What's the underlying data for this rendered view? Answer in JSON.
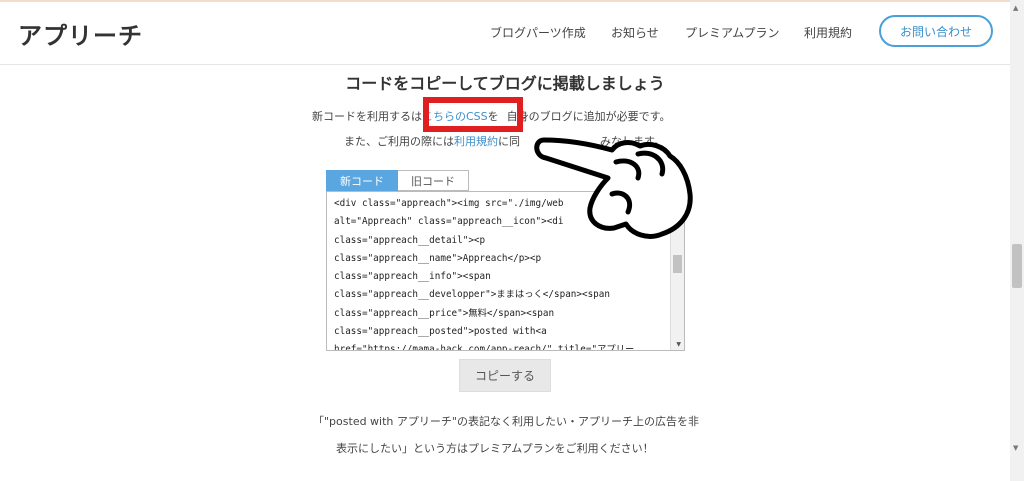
{
  "header": {
    "logo": "アプリーチ",
    "nav": [
      "ブログパーツ作成",
      "お知らせ",
      "プレミアムプラン",
      "利用規約"
    ],
    "contact": "お問い合わせ"
  },
  "main": {
    "title": "コードをコピーしてブログに掲載しましょう",
    "line1_pre": "新コードを利用する",
    "line1_mid": "は",
    "line1_link": "こちらのCSS",
    "line1_post": "を",
    "line1_end": "自身のブログに追加が必要です。",
    "line2_pre": "また、ご利用の際には",
    "line2_link": "利用規約",
    "line2_post": "に同",
    "line2_end": "みなします。",
    "tabs": [
      "新コード",
      "旧コード"
    ],
    "code_lines": [
      "<div class=\"appreach\"><img src=\"./img/web",
      "alt=\"Appreach\" class=\"appreach__icon\"><di",
      "class=\"appreach__detail\"><p",
      "class=\"appreach__name\">Appreach</p><p",
      "class=\"appreach__info\"><span",
      "class=\"appreach__developper\">ままはっく</span><span",
      "class=\"appreach__price\">無料</span><span",
      "class=\"appreach__posted\">posted with<a",
      "href=\"https://mama-hack.com/app-reach/\" title=\"アプリー"
    ],
    "copy_button": "コピーする",
    "note1": "「\"posted with アプリーチ\"の表記なく利用したい・アプリーチ上の広告を非",
    "note2": "表示にしたい」という方はプレミアムプランをご利用ください！"
  }
}
